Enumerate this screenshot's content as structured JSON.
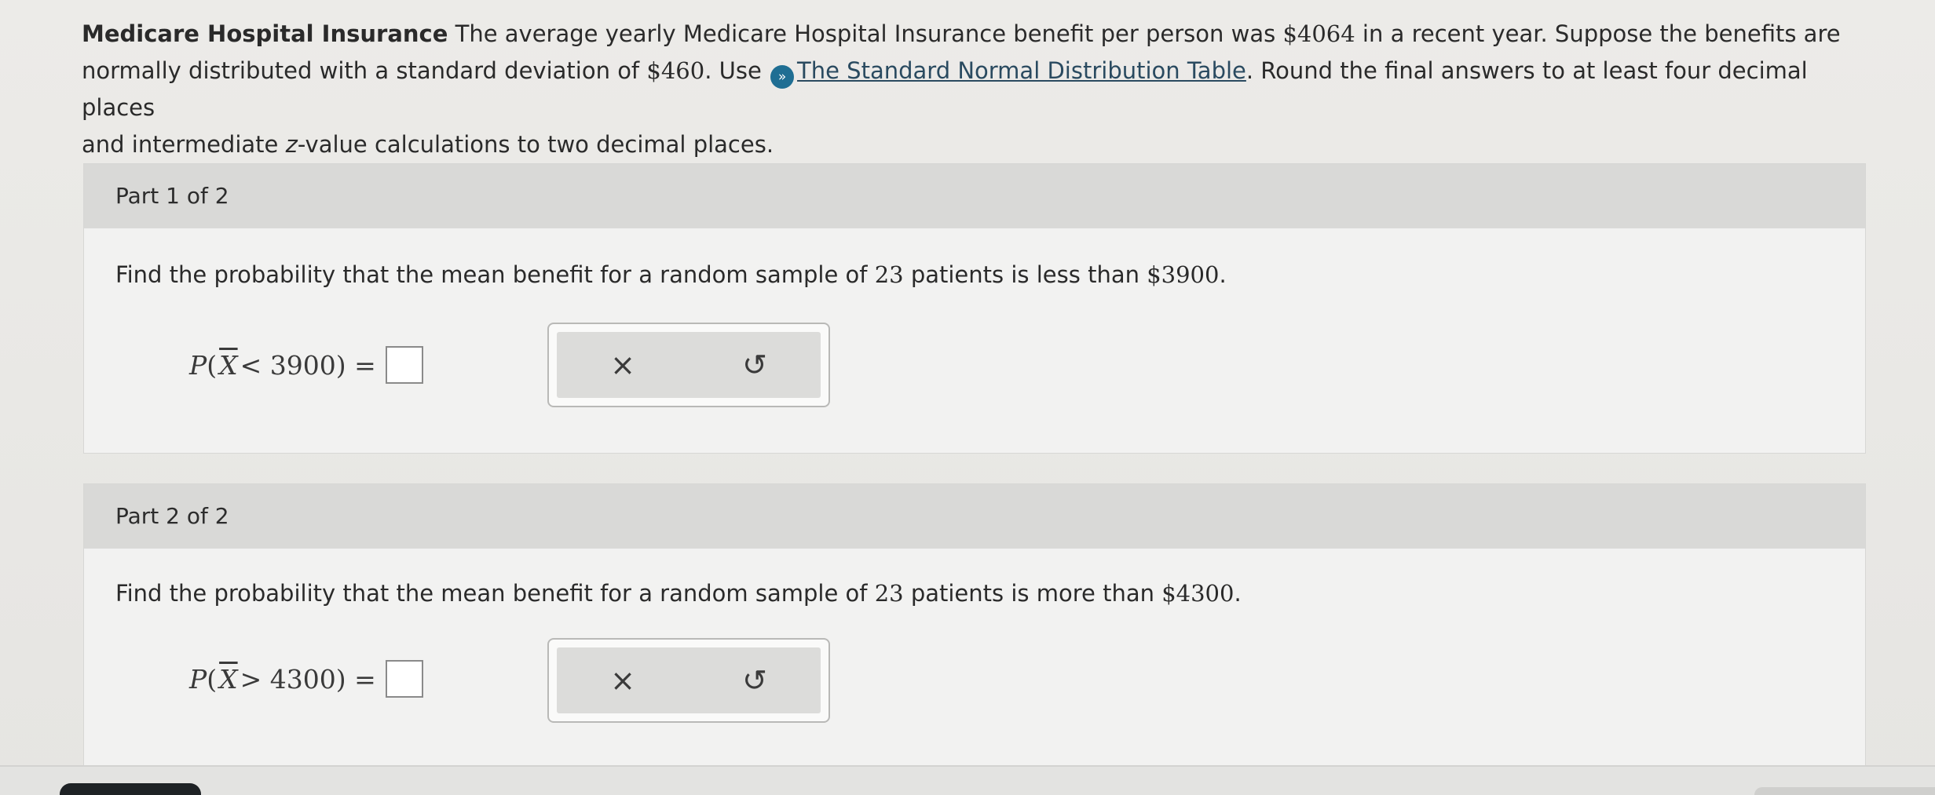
{
  "problem": {
    "title": "Medicare Hospital Insurance",
    "line1_text": " The average yearly Medicare Hospital Insurance benefit per person was ",
    "mean_value": "$4064",
    "line1_end": " in a recent year. Suppose the benefits are",
    "line2_start": "normally distributed with a standard deviation of ",
    "sd_value": "$460",
    "line2_use": ". Use ",
    "link_text": "The Standard Normal Distribution Table",
    "line2_end": ". Round the final answers to at least four decimal places",
    "line3_start": "and intermediate ",
    "z_var": "z",
    "line3_end": "-value calculations to two decimal places."
  },
  "icons": {
    "info": "info-circle-icon",
    "clear": "x-icon",
    "reset": "undo-icon"
  },
  "colors": {
    "info_icon": "#1f6e93",
    "header_bg": "#d9d9d7"
  },
  "parts": [
    {
      "header": "Part 1 of 2",
      "question_text": "Find the probability that the mean benefit for a random sample of ",
      "n": "23",
      "question_mid": " patients is less than ",
      "amount": "$3900",
      "question_end": ".",
      "formula_p": "P",
      "formula_open": "(",
      "formula_xbar": "X",
      "formula_op": " < 3900",
      "formula_close": ") =",
      "clear_label": "×",
      "reset_label": "↺"
    },
    {
      "header": "Part 2 of 2",
      "question_text": "Find the probability that the mean benefit for a random sample of ",
      "n": "23",
      "question_mid": " patients is more than ",
      "amount": "$4300",
      "question_end": ".",
      "formula_p": "P",
      "formula_open": "(",
      "formula_xbar": "X",
      "formula_op": " > 4300",
      "formula_close": ") =",
      "clear_label": "×",
      "reset_label": "↺"
    }
  ]
}
